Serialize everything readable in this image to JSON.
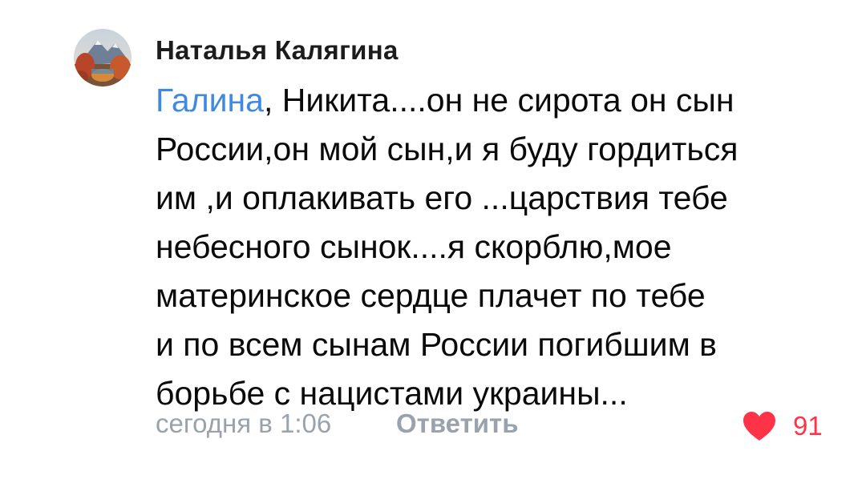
{
  "comment": {
    "author": "Наталья Калягина",
    "avatar_icon": "avatar-mountain-landscape",
    "mention": "Галина",
    "lines": [
      ", Никита....он не сирота он сын",
      "России,он мой сын,и я буду гордиться",
      "им ,и оплакивать его ...царствия тебе",
      "небесного сынок....я скорблю,мое",
      "материнское сердце плачет по тебе",
      "и по всем сынам России погибшим в",
      "борьбе с нацистами украины..."
    ],
    "timestamp": "сегодня в 1:06",
    "reply_label": "Ответить",
    "like_icon": "heart-icon",
    "likes": "91"
  },
  "colors": {
    "mention": "#3f8ae0",
    "meta": "#99a2ad",
    "like": "#ff3347",
    "text": "#0a0a0a"
  }
}
